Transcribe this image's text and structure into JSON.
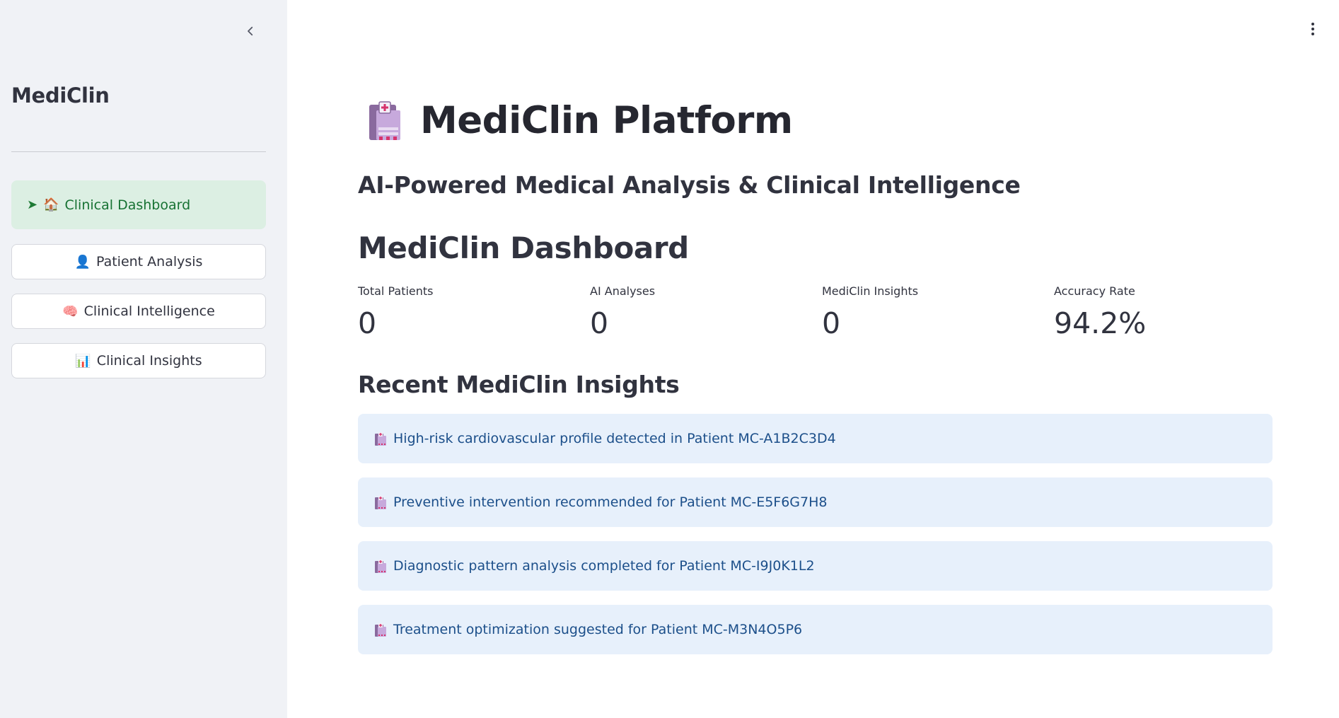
{
  "sidebar": {
    "brand": "MediClin",
    "nav": {
      "active": {
        "arrow": "➤",
        "emoji": "🏠",
        "label": "Clinical Dashboard"
      },
      "items": [
        {
          "emoji": "👤",
          "label": "Patient Analysis"
        },
        {
          "emoji": "🧠",
          "label": "Clinical Intelligence"
        },
        {
          "emoji": "📊",
          "label": "Clinical Insights"
        }
      ]
    }
  },
  "main": {
    "title": "MediClin Platform",
    "subtitle": "AI-Powered Medical Analysis & Clinical Intelligence",
    "dashboard_title": "MediClin Dashboard",
    "metrics": [
      {
        "label": "Total Patients",
        "value": "0"
      },
      {
        "label": "AI Analyses",
        "value": "0"
      },
      {
        "label": "MediClin Insights",
        "value": "0"
      },
      {
        "label": "Accuracy Rate",
        "value": "94.2%"
      }
    ],
    "insights_title": "Recent MediClin Insights",
    "insights": [
      "High-risk cardiovascular profile detected in Patient MC-A1B2C3D4",
      "Preventive intervention recommended for Patient MC-E5F6G7H8",
      "Diagnostic pattern analysis completed for Patient MC-I9J0K1L2",
      "Treatment optimization suggested for Patient MC-M3N4O5P6"
    ]
  },
  "colors": {
    "sidebar_bg": "#f0f2f6",
    "active_nav_bg": "#dcefe3",
    "active_nav_text": "#177233",
    "insight_bg": "#e7f0fb",
    "insight_text": "#1c4f8a"
  },
  "icons": {
    "collapse": "chevron-left-icon",
    "menu": "kebab-menu-icon",
    "title": "hospital-icon",
    "insight": "hospital-icon"
  }
}
